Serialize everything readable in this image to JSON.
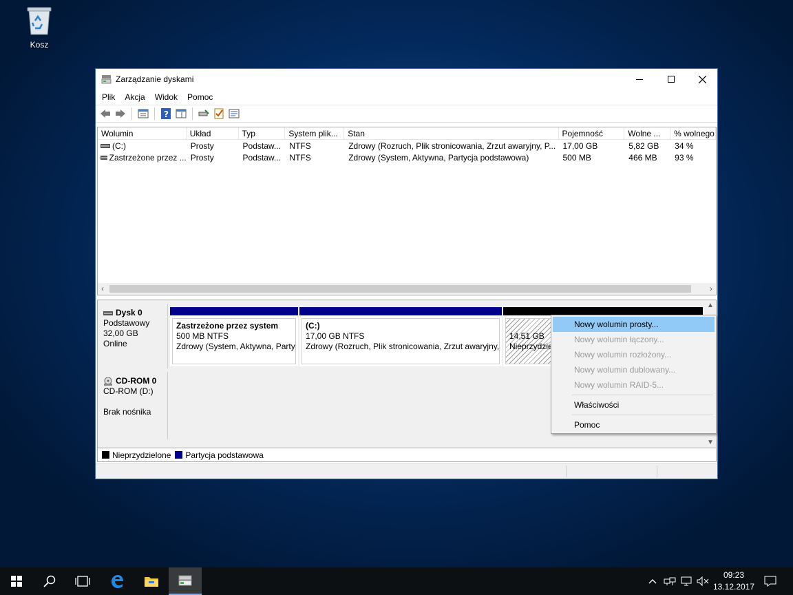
{
  "desktop": {
    "recycle_bin_label": "Kosz"
  },
  "window": {
    "title": "Zarządzanie dyskami",
    "menu": [
      "Plik",
      "Akcja",
      "Widok",
      "Pomoc"
    ],
    "columns": [
      "Wolumin",
      "Układ",
      "Typ",
      "System plik...",
      "Stan",
      "Pojemność",
      "Wolne ...",
      "% wolnego"
    ],
    "volumes": [
      [
        "(C:)",
        "Prosty",
        "Podstaw...",
        "NTFS",
        "Zdrowy (Rozruch, Plik stronicowania, Zrzut awaryjny, P...",
        "17,00 GB",
        "5,82 GB",
        "34 %"
      ],
      [
        "Zastrzeżone przez ...",
        "Prosty",
        "Podstaw...",
        "NTFS",
        "Zdrowy (System, Aktywna, Partycja podstawowa)",
        "500 MB",
        "466 MB",
        "93 %"
      ]
    ],
    "disk0": {
      "name": "Dysk 0",
      "type": "Podstawowy",
      "size": "32,00 GB",
      "status": "Online",
      "partitions": [
        {
          "title": "Zastrzeżone przez system",
          "size": "500 MB NTFS",
          "status": "Zdrowy (System, Aktywna, Partycja podstawowa)"
        },
        {
          "title": "(C:)",
          "size": "17,00 GB NTFS",
          "status": "Zdrowy (Rozruch, Plik stronicowania, Zrzut awaryjny, Partycja podstawowa)"
        },
        {
          "size": "14,51 GB",
          "status": "Nieprzydzielone"
        }
      ]
    },
    "cdrom": {
      "name": "CD-ROM 0",
      "drive": "CD-ROM (D:)",
      "media": "Brak nośnika"
    },
    "legend": [
      "Nieprzydzielone",
      "Partycja podstawowa"
    ],
    "colors": {
      "primary_partition": "#00008b",
      "unallocated": "#000000",
      "highlight": "#91c9f7"
    }
  },
  "context_menu": {
    "items": [
      "Nowy wolumin prosty...",
      "Nowy wolumin łączony...",
      "Nowy wolumin rozłożony...",
      "Nowy wolumin dublowany...",
      "Nowy wolumin RAID-5..."
    ],
    "properties": "Właściwości",
    "help": "Pomoc"
  },
  "taskbar": {
    "time": "09:23",
    "date": "13.12.2017"
  }
}
